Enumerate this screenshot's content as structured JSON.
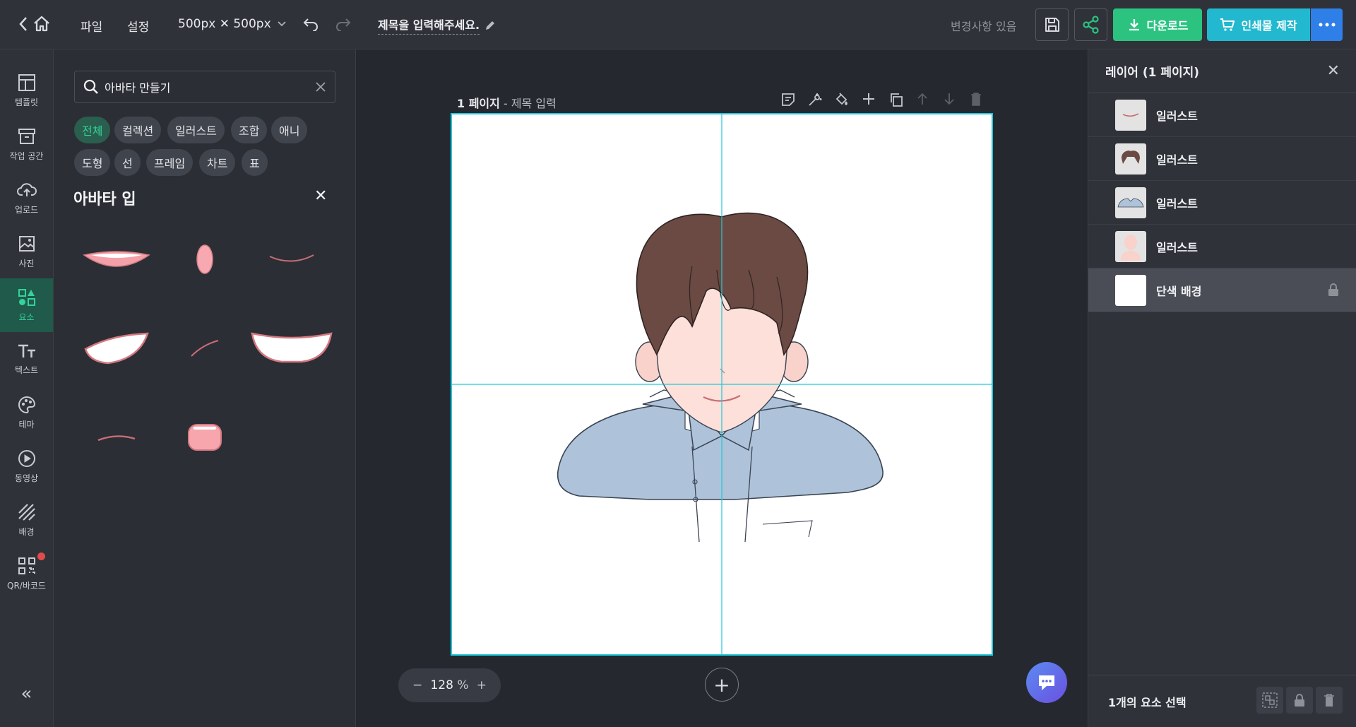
{
  "topbar": {
    "file_menu": "파일",
    "settings_menu": "설정",
    "size": "500px ✕ 500px",
    "title": "제목을 입력해주세요.",
    "status": "변경사항 있음",
    "download": "다운로드",
    "print": "인쇄물 제작"
  },
  "rail": {
    "items": [
      {
        "label": "템플릿",
        "icon": "template-icon"
      },
      {
        "label": "작업 공간",
        "icon": "archive-icon"
      },
      {
        "label": "업로드",
        "icon": "upload-icon"
      },
      {
        "label": "사진",
        "icon": "photo-icon"
      },
      {
        "label": "요소",
        "icon": "elements-icon",
        "active": true
      },
      {
        "label": "텍스트",
        "icon": "text-icon"
      },
      {
        "label": "테마",
        "icon": "palette-icon"
      },
      {
        "label": "동영상",
        "icon": "play-icon"
      },
      {
        "label": "배경",
        "icon": "background-icon"
      },
      {
        "label": "QR/바코드",
        "icon": "qr-icon"
      }
    ],
    "collapse": "«"
  },
  "panel": {
    "search_value": "아바타 만들기",
    "chips": [
      "전체",
      "컬렉션",
      "일러스트",
      "조합",
      "애니",
      "도형",
      "선",
      "프레임",
      "차트",
      "표"
    ],
    "active_chip": "전체",
    "subcategory_title": "아바타 입"
  },
  "workspace": {
    "page_number": "1 페이지",
    "page_sep": " - ",
    "page_title_placeholder": "제목 입력",
    "zoom_value": "128",
    "zoom_unit": "%"
  },
  "layers": {
    "title": "레이어 (1 페이지)",
    "items": [
      {
        "name": "일러스트",
        "thumb": "mouth"
      },
      {
        "name": "일러스트",
        "thumb": "hair"
      },
      {
        "name": "일러스트",
        "thumb": "shirt"
      },
      {
        "name": "일러스트",
        "thumb": "body"
      },
      {
        "name": "단색 배경",
        "thumb": "white",
        "selected": true,
        "locked": true
      }
    ],
    "selection_status": "1개의 요소 선택"
  },
  "colors": {
    "accent_green": "#2cc381",
    "accent_cyan": "#22b8cf",
    "accent_blue": "#2f7fe8",
    "guide": "#1fc9db"
  }
}
